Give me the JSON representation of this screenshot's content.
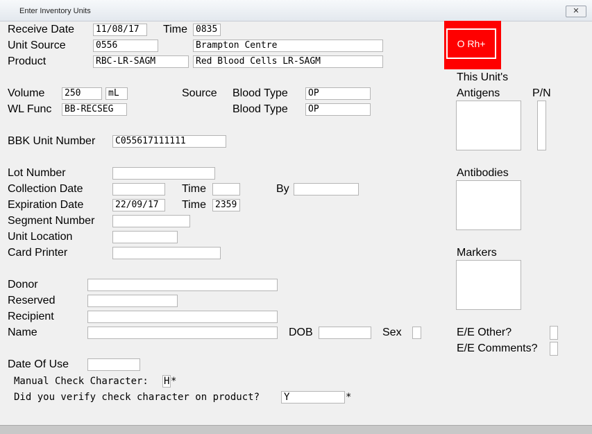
{
  "window": {
    "title": "Enter Inventory Units",
    "close_label": "✕"
  },
  "header": {
    "receive_date_label": "Receive Date",
    "receive_date": "11/08/17",
    "time_label": "Time",
    "time": "0835",
    "unit_source_label": "Unit Source",
    "unit_source_code": "0556",
    "unit_source_name": "Brampton Centre",
    "product_label": "Product",
    "product_code": "RBC-LR-SAGM",
    "product_name": "Red Blood Cells LR-SAGM"
  },
  "abo_badge": {
    "text": "O Rh+",
    "color": "#ff0000"
  },
  "unit": {
    "volume_label": "Volume",
    "volume": "250",
    "volume_unit": "mL",
    "wl_func_label": "WL Func",
    "wl_func": "BB-RECSEG",
    "source_label": "Source",
    "blood_type_label": "Blood Type",
    "blood_type_1": "OP",
    "blood_type_2": "OP",
    "bbk_label": "BBK Unit Number",
    "bbk_number": "C055617111111"
  },
  "details": {
    "lot_label": "Lot Number",
    "lot": "",
    "collection_label": "Collection Date",
    "collection": "",
    "collection_time_label": "Time",
    "collection_time": "",
    "by_label": "By",
    "by": "",
    "expiration_label": "Expiration Date",
    "expiration": "22/09/17",
    "expiration_time_label": "Time",
    "expiration_time": "2359",
    "segment_label": "Segment Number",
    "segment": "",
    "location_label": "Unit Location",
    "location": "",
    "printer_label": "Card Printer",
    "printer": ""
  },
  "people": {
    "donor_label": "Donor",
    "donor": "",
    "reserved_label": "Reserved",
    "reserved": "",
    "recipient_label": "Recipient",
    "recipient": "",
    "name_label": "Name",
    "name": "",
    "dob_label": "DOB",
    "dob": "",
    "sex_label": "Sex",
    "sex": ""
  },
  "use": {
    "date_of_use_label": "Date Of Use",
    "date_of_use": "",
    "manual_check_label": "Manual Check Character:",
    "manual_check": "H",
    "manual_check_star": "*",
    "verify_label": "Did you verify check character on product?",
    "verify": "Y",
    "verify_star": "*"
  },
  "right_panel": {
    "antigens_label_1": "This Unit's",
    "antigens_label_2": "Antigens",
    "pn_label": "P/N",
    "antibodies_label": "Antibodies",
    "markers_label": "Markers",
    "ee_other_label": "E/E Other?",
    "ee_comments_label": "E/E Comments?"
  }
}
